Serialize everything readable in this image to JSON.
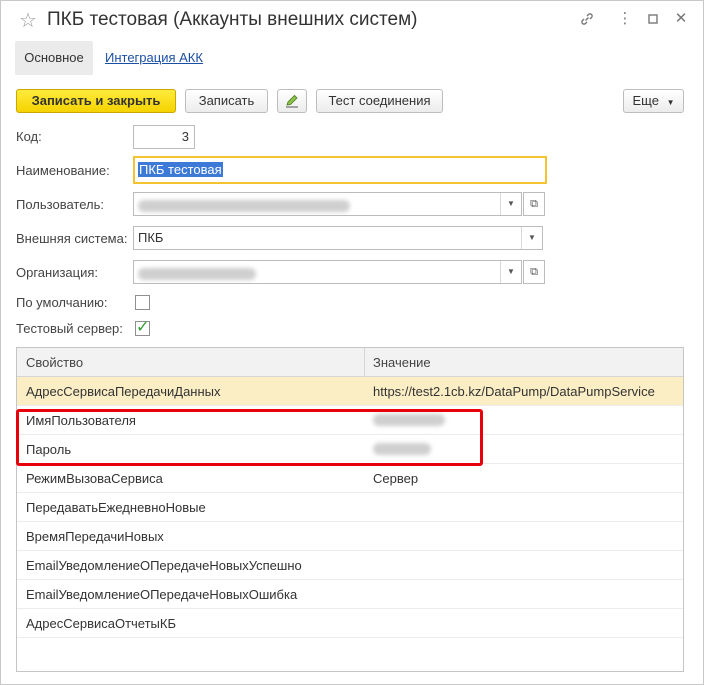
{
  "window": {
    "title": "ПКБ тестовая (Аккаунты внешних систем)",
    "icons": [
      "link-icon",
      "more-icon",
      "maximize-icon",
      "close-icon"
    ]
  },
  "tabs": {
    "main": "Основное",
    "integration": "Интеграция АКК"
  },
  "toolbar": {
    "save_close": "Записать и закрыть",
    "save": "Записать",
    "test_connection": "Тест соединения",
    "more": "Еще"
  },
  "form": {
    "code": {
      "label": "Код:",
      "value": "3"
    },
    "name": {
      "label": "Наименование:",
      "value": "ПКБ тестовая"
    },
    "user": {
      "label": "Пользователь:"
    },
    "external_system": {
      "label": "Внешняя система:",
      "value": "ПКБ"
    },
    "organization": {
      "label": "Организация:"
    },
    "default": {
      "label": "По умолчанию:",
      "checked": false
    },
    "test_server": {
      "label": "Тестовый сервер:",
      "checked": true
    }
  },
  "table": {
    "headers": {
      "property": "Свойство",
      "value": "Значение"
    },
    "rows": [
      {
        "property": "АдресСервисаПередачиДанных",
        "value": "https://test2.1cb.kz/DataPump/DataPumpService"
      },
      {
        "property": "ИмяПользователя",
        "value": ""
      },
      {
        "property": "Пароль",
        "value": ""
      },
      {
        "property": "РежимВызоваСервиса",
        "value": "Сервер"
      },
      {
        "property": "ПередаватьЕжедневноНовые",
        "value": ""
      },
      {
        "property": "ВремяПередачиНовых",
        "value": ""
      },
      {
        "property": "EmailУведомлениеОПередачеНовыхУспешно",
        "value": ""
      },
      {
        "property": "EmailУведомлениеОПередачеНовыхОшибка",
        "value": ""
      },
      {
        "property": "АдресСервисаОтчетыКБ",
        "value": ""
      }
    ]
  },
  "colors": {
    "accent_yellow": "#f5d300",
    "highlight": "#e8000b",
    "link": "#1b4fa3",
    "selected_row": "#fbeec5"
  }
}
